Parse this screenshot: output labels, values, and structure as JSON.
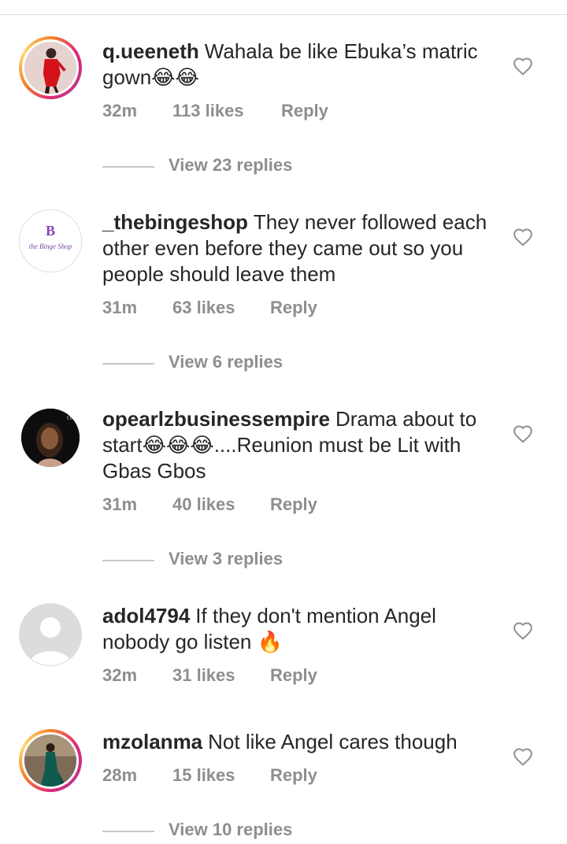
{
  "comments": [
    {
      "username": "q.ueeneth",
      "text": "Wahala be like Ebuka’s matric gown😂😂",
      "time": "32m",
      "likes": "113 likes",
      "reply": "Reply",
      "view_replies": "View 23 replies",
      "avatar": "story-ring-avatar-red-dress"
    },
    {
      "username": "_thebingeshop",
      "text": "They never followed each other even before they came out so you people should leave them",
      "time": "31m",
      "likes": "63 likes",
      "reply": "Reply",
      "view_replies": "View 6 replies",
      "avatar": "binge-shop-logo"
    },
    {
      "username": "opearlzbusinessempire",
      "text": "Drama about to start😂😂😂....Reunion must be Lit with Gbas Gbos",
      "time": "31m",
      "likes": "40 likes",
      "reply": "Reply",
      "view_replies": "View 3 replies",
      "avatar": "portrait-dark-background"
    },
    {
      "username": "adol4794",
      "text": "If they don't mention Angel nobody go listen 🔥",
      "time": "32m",
      "likes": "31 likes",
      "reply": "Reply",
      "avatar": "default-user-avatar"
    },
    {
      "username": "mzolanma",
      "text": "Not like Angel cares though",
      "time": "28m",
      "likes": "15 likes",
      "reply": "Reply",
      "view_replies": "View 10 replies",
      "avatar": "story-ring-avatar-green-gown"
    }
  ],
  "logo_text": "the Binge Shop",
  "colors": {
    "text": "#262626",
    "secondary": "#8e8e8e",
    "divider": "#dbdbdb"
  }
}
